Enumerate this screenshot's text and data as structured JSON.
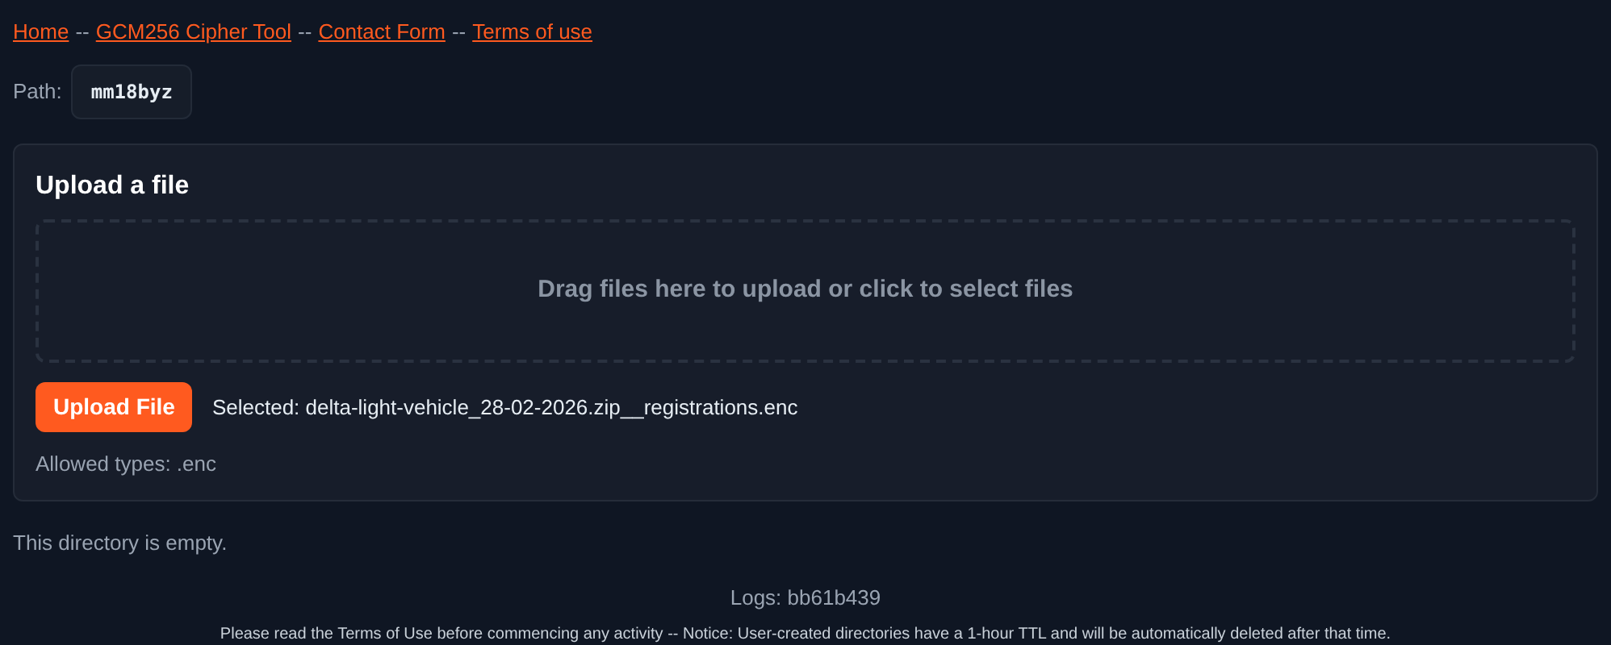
{
  "nav": [
    {
      "kind": "link",
      "text": "Home"
    },
    {
      "kind": "separator",
      "text": "--"
    },
    {
      "kind": "link",
      "text": "GCM256 Cipher Tool"
    },
    {
      "kind": "separator",
      "text": "--"
    },
    {
      "kind": "link",
      "text": "Contact Form"
    },
    {
      "kind": "separator",
      "text": "--"
    },
    {
      "kind": "link",
      "text": "Terms of use"
    }
  ],
  "path": {
    "label": "Path:",
    "value": "mm18byz"
  },
  "upload": {
    "title": "Upload a file",
    "dropzone": "Drag files here to upload or click to select files",
    "button": "Upload File",
    "selected": "Selected: delta-light-vehicle_28-02-2026.zip__registrations.enc",
    "allowed": "Allowed types: .enc"
  },
  "empty_message": "This directory is empty.",
  "footer": {
    "logs": "Logs: bb61b439",
    "notice": "Please read the Terms of Use before commencing any activity -- Notice: User-created directories have a 1-hour TTL and will be automatically deleted after that time."
  }
}
